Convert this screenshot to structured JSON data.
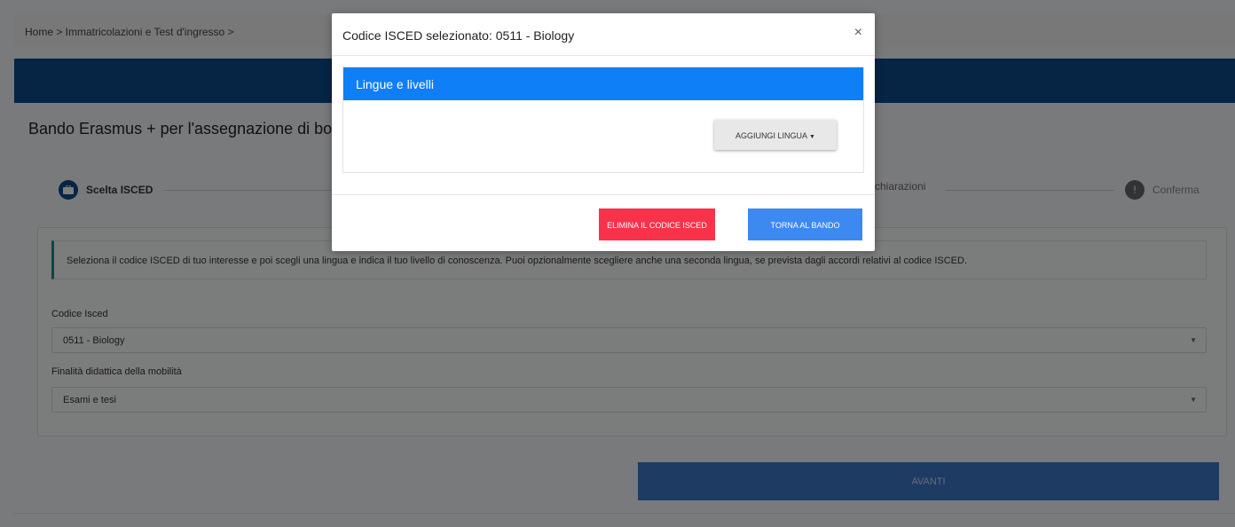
{
  "breadcrumb": "Home > Immatricolazioni e Test d'ingresso >",
  "page_title": "Bando Erasmus + per l'assegnazione di borse",
  "stepper": {
    "step1_label": "Scelta ISCED",
    "step3_label": "chiarazioni",
    "step4_label": "Conferma"
  },
  "info_text": "Seleziona il codice ISCED di tuo interesse e poi scegli una lingua e indica il tuo livello di conoscenza. Puoi opzionalmente scegliere anche una seconda lingua, se prevista dagli accordi relativi al codice ISCED.",
  "form": {
    "isced_label": "Codice Isced",
    "isced_value": "0511 - Biology",
    "finalita_label": "Finalità didattica della mobilità",
    "finalita_value": "Esami e tesi"
  },
  "avanti_label": "AVANTI",
  "modal": {
    "title": "Codice ISCED selezionato: 0511 - Biology",
    "close_glyph": "×",
    "panel_title": "Lingue e livelli",
    "add_language_label": "AGGIUNGI LINGUA",
    "delete_label": "ELIMINA IL CODICE ISCED",
    "back_label": "TORNA AL BANDO"
  },
  "colors": {
    "banner": "#0d4a8a",
    "panel_header": "#0f7ff7",
    "delete_button": "#f7324a",
    "back_button": "#3c89f1",
    "avanti_button": "#3c76c9"
  }
}
